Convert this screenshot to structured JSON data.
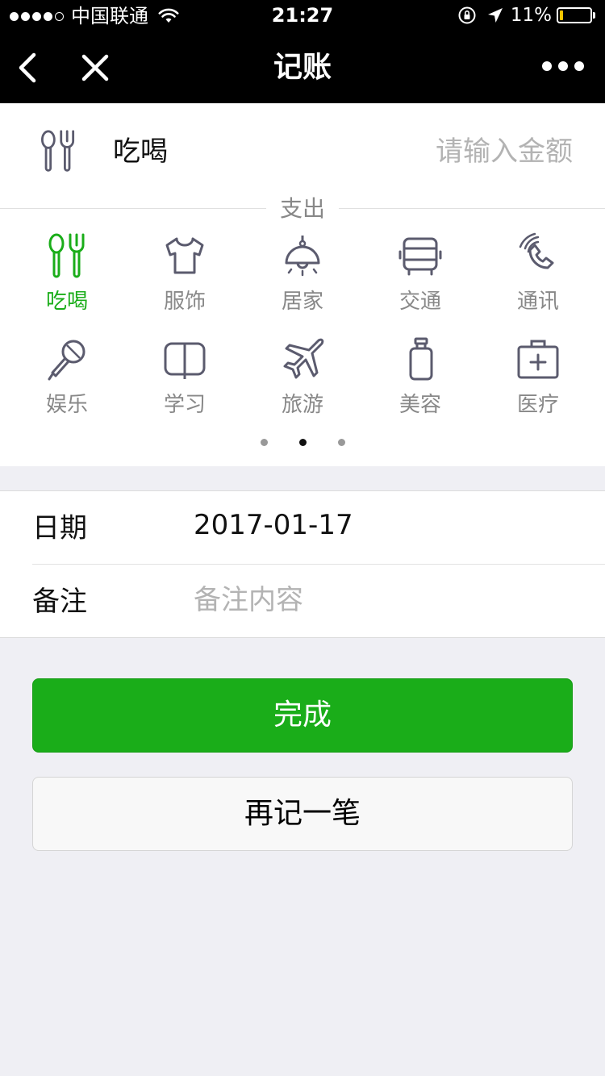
{
  "status_bar": {
    "carrier": "中国联通",
    "time": "21:27",
    "battery_percent": "11%",
    "battery_level": 0.11,
    "signal_bars_filled": 4,
    "signal_bars_total": 5
  },
  "nav": {
    "title": "记账",
    "back_icon": "chevron-left-icon",
    "close_icon": "close-icon",
    "more_icon": "more-dots-icon"
  },
  "selected_category": {
    "name": "吃喝",
    "icon": "utensils-icon"
  },
  "amount": {
    "value": "",
    "placeholder": "请输入金额"
  },
  "section_label": "支出",
  "categories": [
    {
      "label": "吃喝",
      "icon": "utensils-icon",
      "active": true
    },
    {
      "label": "服饰",
      "icon": "shirt-icon",
      "active": false
    },
    {
      "label": "居家",
      "icon": "lamp-icon",
      "active": false
    },
    {
      "label": "交通",
      "icon": "bus-icon",
      "active": false
    },
    {
      "label": "通讯",
      "icon": "phone-icon",
      "active": false
    },
    {
      "label": "娱乐",
      "icon": "microphone-icon",
      "active": false
    },
    {
      "label": "学习",
      "icon": "book-icon",
      "active": false
    },
    {
      "label": "旅游",
      "icon": "airplane-icon",
      "active": false
    },
    {
      "label": "美容",
      "icon": "lotion-bottle-icon",
      "active": false
    },
    {
      "label": "医疗",
      "icon": "medical-kit-icon",
      "active": false
    }
  ],
  "pager": {
    "total": 3,
    "current": 2
  },
  "form": {
    "date_label": "日期",
    "date_value": "2017-01-17",
    "note_label": "备注",
    "note_value": "",
    "note_placeholder": "备注内容"
  },
  "buttons": {
    "done": "完成",
    "again": "再记一笔"
  },
  "colors": {
    "accent": "#1aad19",
    "icon_gray": "#5b5b6e",
    "background": "#efeff4"
  }
}
